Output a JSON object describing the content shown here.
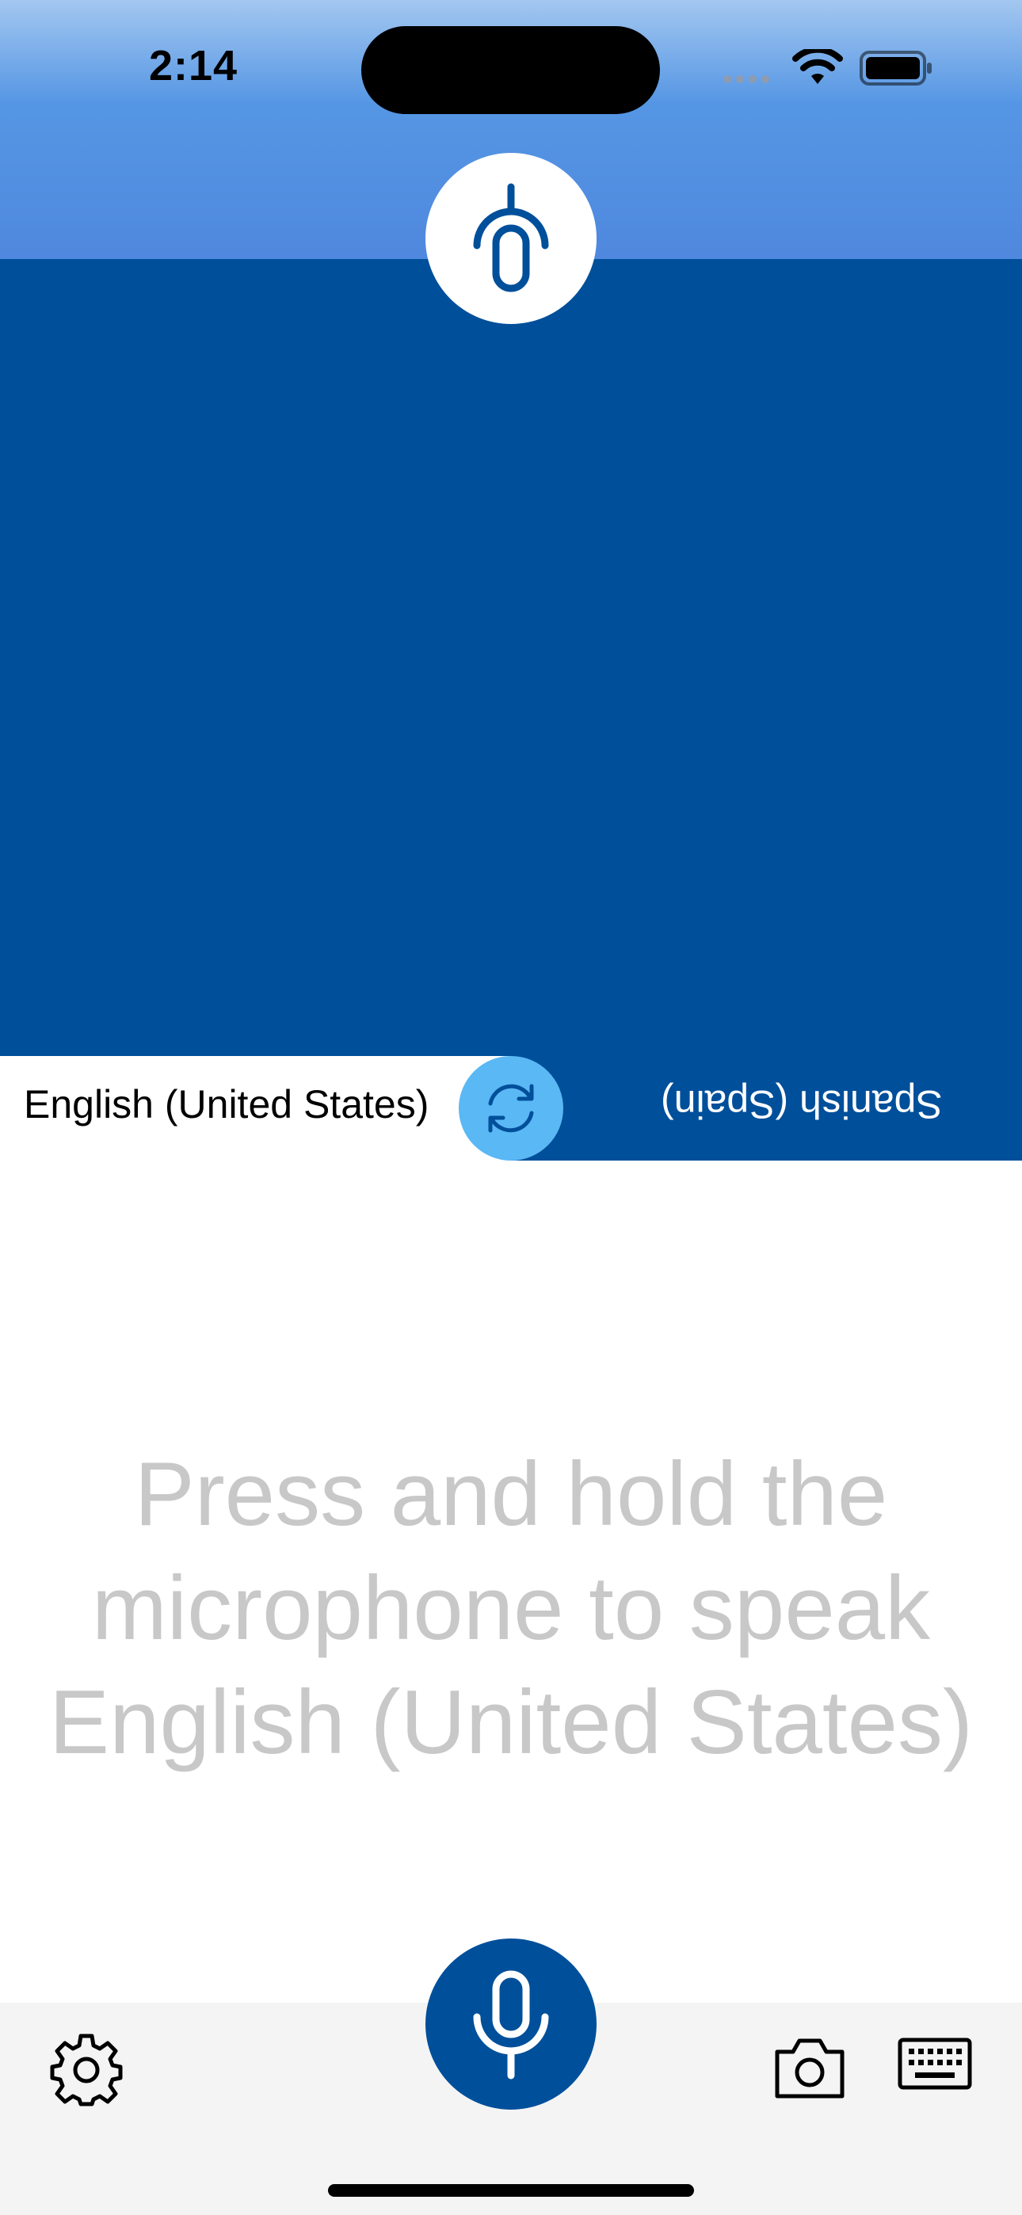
{
  "status_bar": {
    "time": "2:14"
  },
  "languages": {
    "source": "English (United States)",
    "target": "Spanish (Spain)"
  },
  "prompt": {
    "line1": "Press and hold the",
    "line2": "microphone to speak",
    "line3": "English (United States)"
  },
  "colors": {
    "primary": "#004f9a",
    "swap_accent": "#5ab8f5",
    "prompt_text": "#c8c8c8",
    "bottom_bar": "#f4f4f5"
  },
  "icons": {
    "top_mic": "microphone-icon-inverted",
    "swap": "swap-arrows-icon",
    "mic": "microphone-icon",
    "settings": "gear-icon",
    "camera": "camera-icon",
    "keyboard": "keyboard-icon"
  }
}
